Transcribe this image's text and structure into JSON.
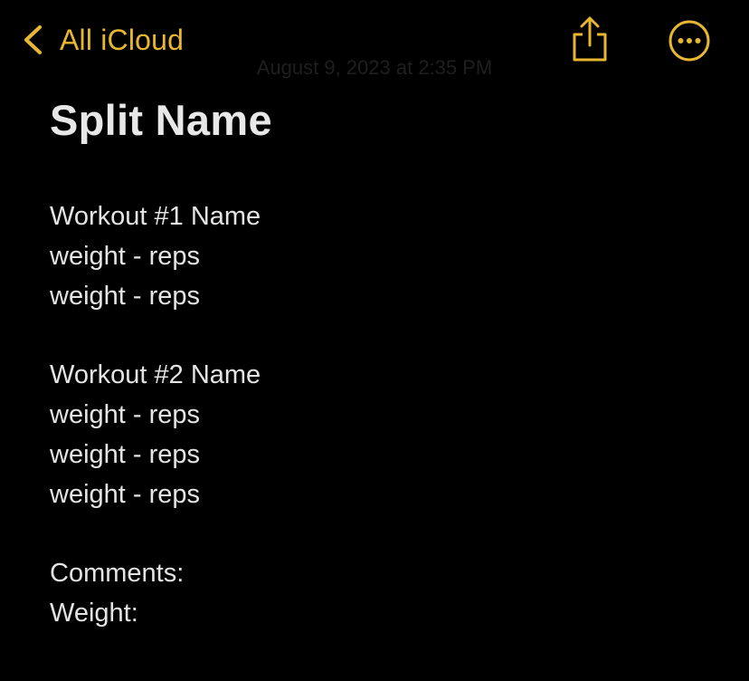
{
  "nav": {
    "back_label": "All iCloud",
    "back_icon": "chevron-left-icon",
    "share_icon": "share-icon",
    "more_icon": "ellipsis-circle-icon",
    "accent_color": "#e7b731"
  },
  "note": {
    "timestamp": "August 9, 2023 at 2:35 PM",
    "title": "Split Name",
    "lines": [
      "Workout #1 Name",
      "weight - reps",
      "weight - reps",
      "",
      "Workout #2 Name",
      "weight - reps",
      "weight - reps",
      "weight - reps",
      "",
      "Comments:",
      "Weight:"
    ]
  }
}
